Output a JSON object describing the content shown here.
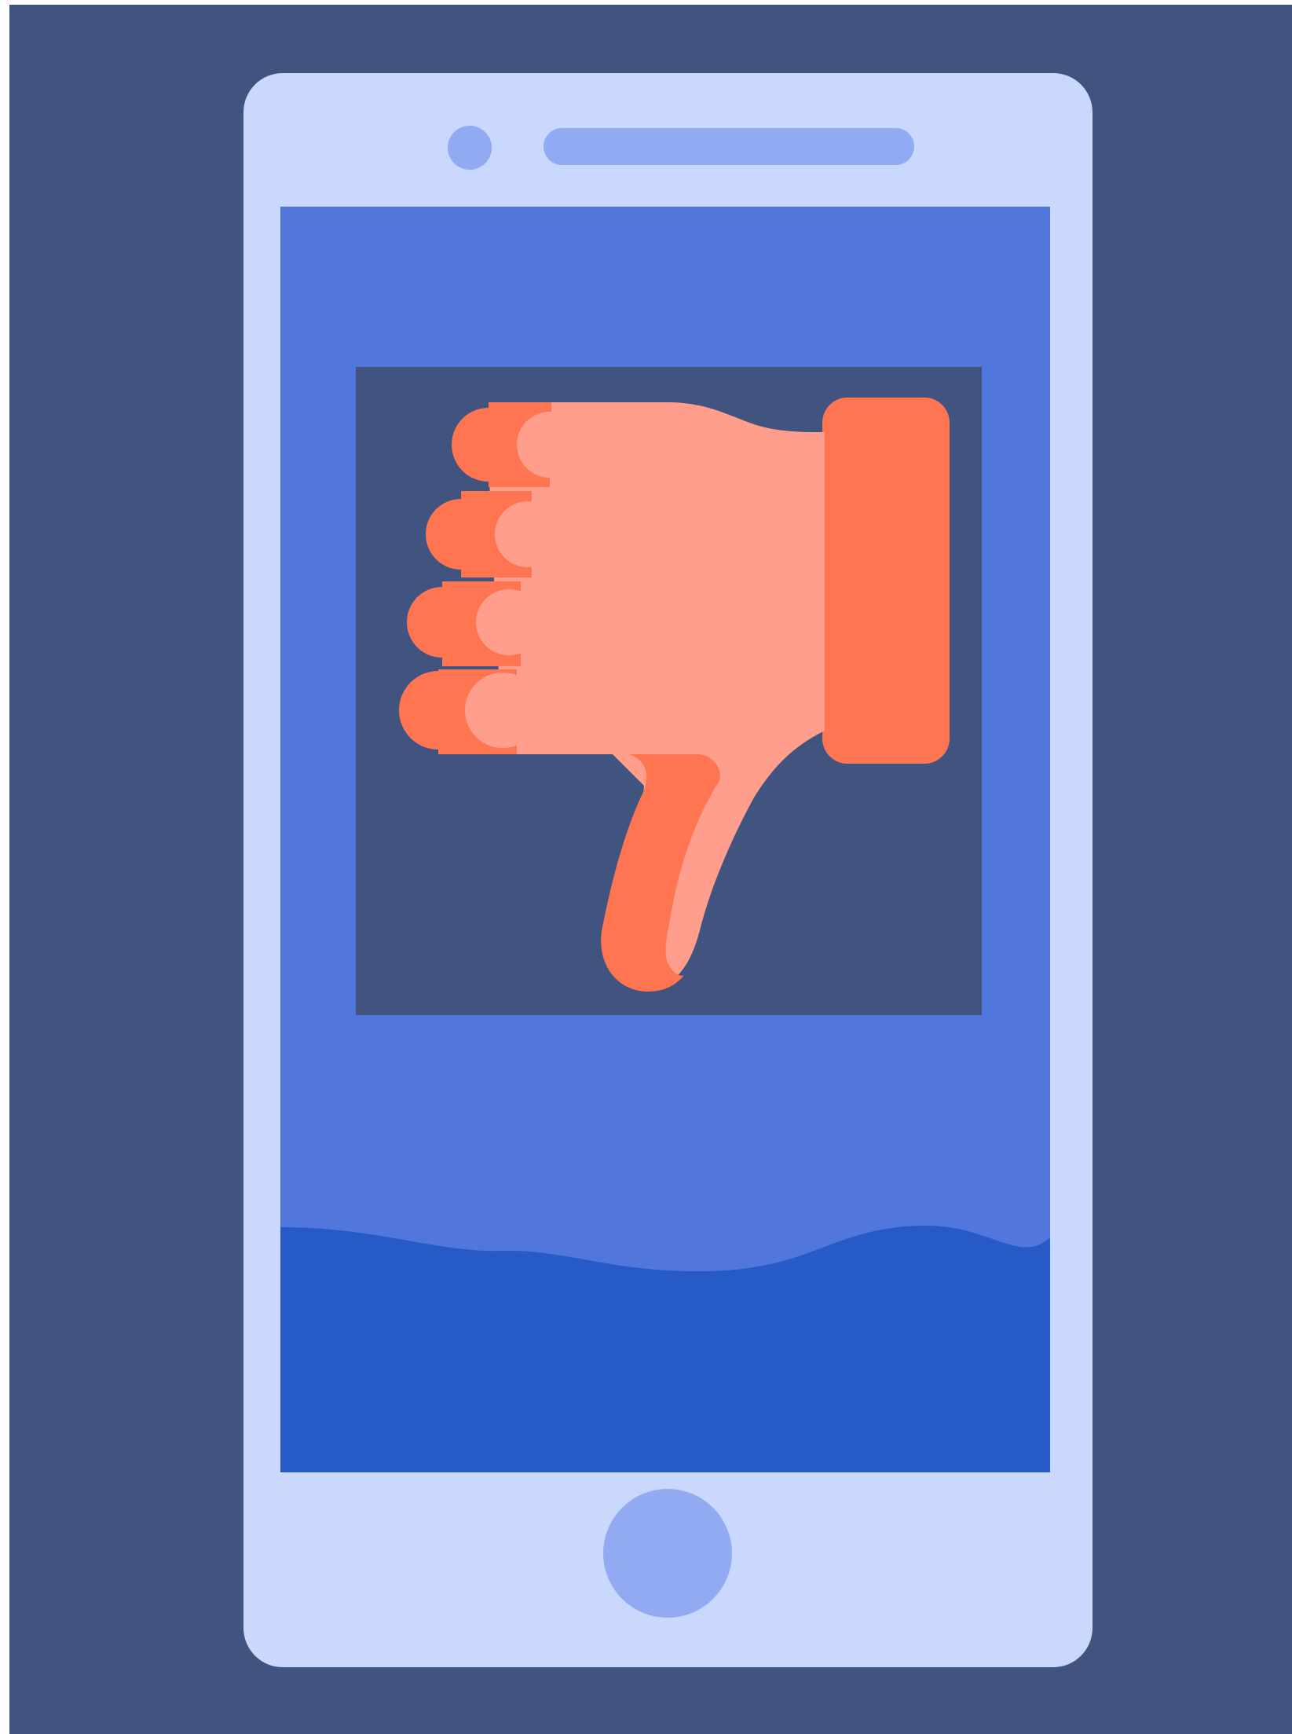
{
  "scene": {
    "subject": "smartphone",
    "screen_content": "thumbs-down-icon",
    "colors": {
      "background": "#41537f",
      "phone_body": "#c9d8fc",
      "phone_accents": "#91aaf1",
      "screen": "#5177dc",
      "screen_wave": "#265ac6",
      "image_frame": "#41537f",
      "hand_dark": "#ff7552",
      "hand_light": "#ff9e8c"
    }
  }
}
